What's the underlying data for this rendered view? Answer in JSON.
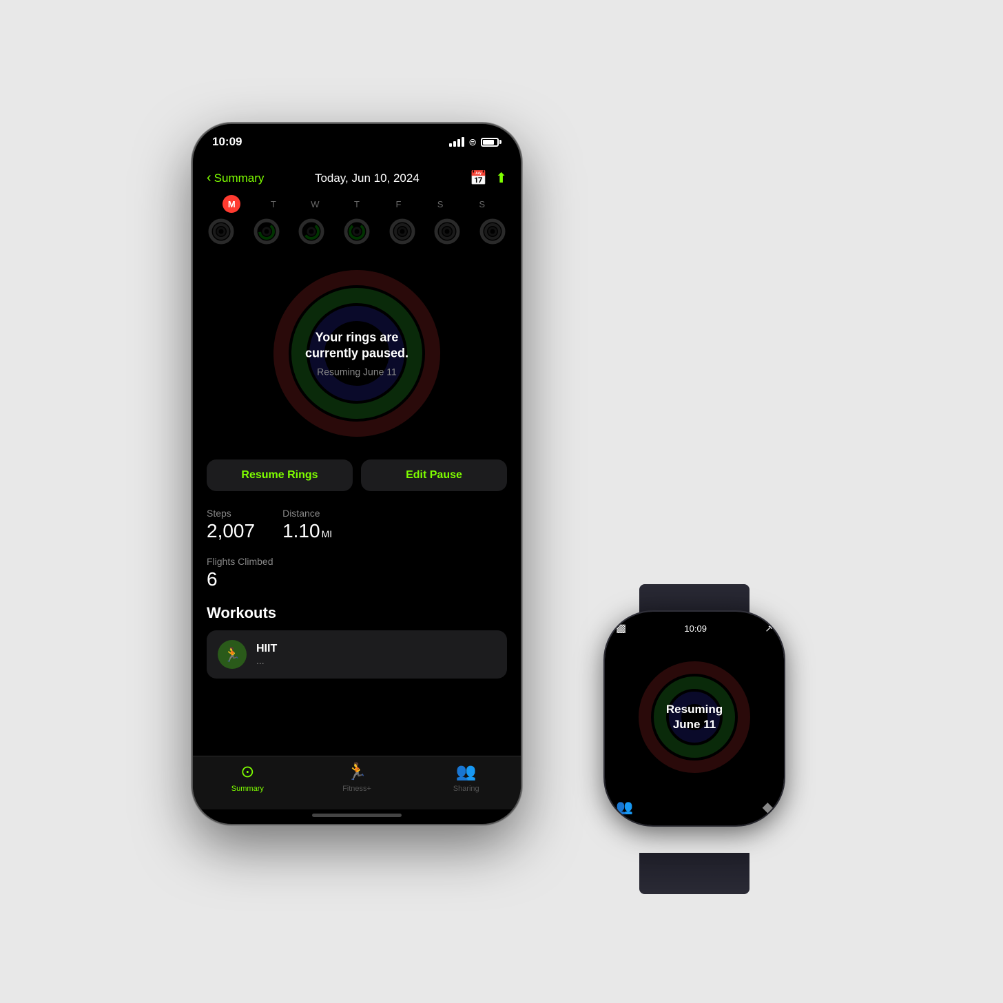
{
  "phone": {
    "status_time": "10:09",
    "nav": {
      "back_label": "Summary",
      "title": "Today, Jun 10, 2024"
    },
    "days": {
      "labels": [
        "M",
        "T",
        "W",
        "T",
        "F",
        "S",
        "S"
      ],
      "today_index": 0
    },
    "ring_status": {
      "title": "Your rings are currently paused.",
      "subtitle": "Resuming June 11"
    },
    "buttons": {
      "resume": "Resume Rings",
      "edit": "Edit Pause"
    },
    "stats": {
      "steps_label": "Steps",
      "steps_value": "2,007",
      "distance_label": "Distance",
      "distance_value": "1.10",
      "distance_unit": "MI",
      "flights_label": "Flights Climbed",
      "flights_value": "6"
    },
    "workouts": {
      "title": "Workouts",
      "items": [
        {
          "name": "HIIT",
          "icon": "🏃"
        }
      ]
    },
    "tabs": [
      {
        "label": "Summary",
        "active": true
      },
      {
        "label": "Fitness+",
        "active": false
      },
      {
        "label": "Sharing",
        "active": false
      }
    ]
  },
  "watch": {
    "time": "10:09",
    "ring_text_line1": "Resuming",
    "ring_text_line2": "June 11"
  },
  "colors": {
    "accent_green": "#7fff00",
    "ring_red": "#ff3b30",
    "ring_green": "#00e000",
    "ring_blue": "#00bfff",
    "bg_dark": "#1c1c1e",
    "bg_black": "#000000"
  }
}
